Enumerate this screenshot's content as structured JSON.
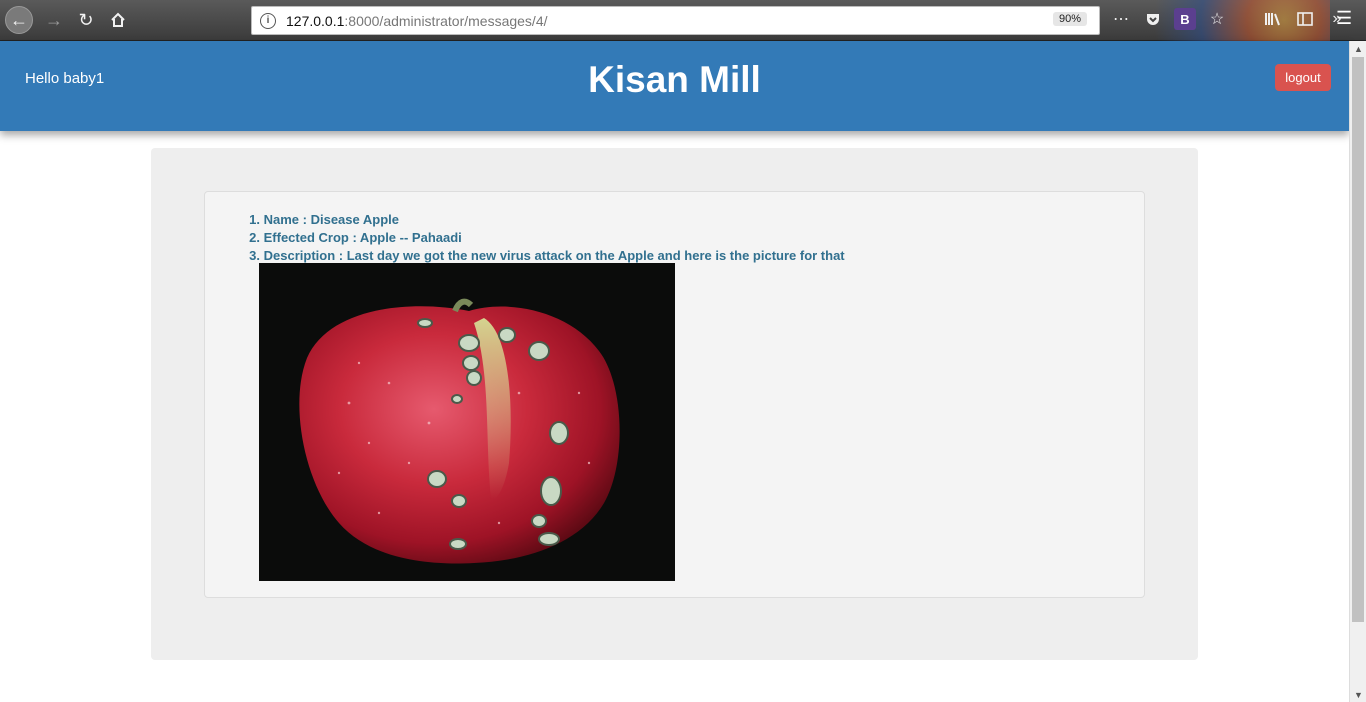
{
  "browser": {
    "url_host": "127.0.0.1",
    "url_path": ":8000/administrator/messages/4/",
    "zoom": "90%",
    "info_icon": "i"
  },
  "header": {
    "greeting": "Hello baby1",
    "title": "Kisan Mill",
    "logout_label": "logout",
    "bg_color": "#337ab7",
    "logout_color": "#d9534f"
  },
  "message": {
    "items": [
      {
        "num": "1.",
        "text": "Name : Disease Apple"
      },
      {
        "num": "2.",
        "text": "Effected Crop : Apple -- Pahaadi"
      },
      {
        "num": "3.",
        "text": "Description : Last day we got the new virus attack on the Apple and here is the picture for that"
      }
    ],
    "photo_icon": "diseased-apple-photo"
  }
}
